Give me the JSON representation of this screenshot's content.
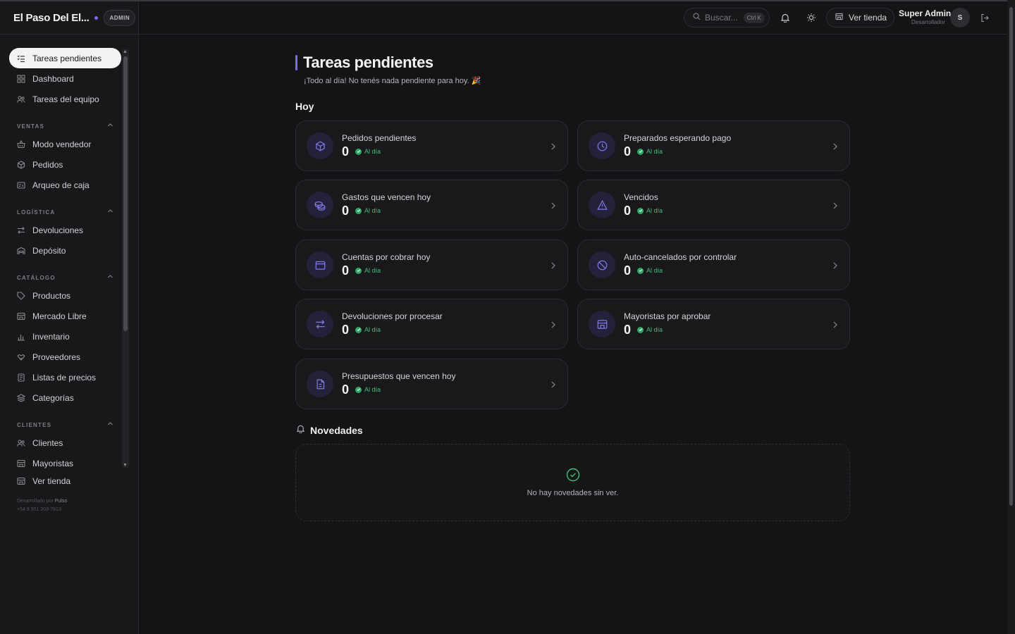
{
  "app": {
    "brand": "El Paso Del El...",
    "badge": "ADMIN"
  },
  "sidebar": {
    "top_items": [
      {
        "label": "Tareas pendientes",
        "icon": "list-check-icon",
        "active": true
      },
      {
        "label": "Dashboard",
        "icon": "grid-icon"
      },
      {
        "label": "Tareas del equipo",
        "icon": "users-icon"
      }
    ],
    "sections": [
      {
        "title": "VENTAS",
        "items": [
          {
            "label": "Modo vendedor",
            "icon": "basket-icon"
          },
          {
            "label": "Pedidos",
            "icon": "box-icon"
          },
          {
            "label": "Arqueo de caja",
            "icon": "cash-register-icon"
          }
        ]
      },
      {
        "title": "LOGÍSTICA",
        "items": [
          {
            "label": "Devoluciones",
            "icon": "arrows-swap-icon"
          },
          {
            "label": "Depósito",
            "icon": "warehouse-icon"
          }
        ]
      },
      {
        "title": "CATÁLOGO",
        "items": [
          {
            "label": "Productos",
            "icon": "tag-icon"
          },
          {
            "label": "Mercado Libre",
            "icon": "store-icon"
          },
          {
            "label": "Inventario",
            "icon": "bar-chart-icon"
          },
          {
            "label": "Proveedores",
            "icon": "handshake-icon"
          },
          {
            "label": "Listas de precios",
            "icon": "price-list-icon"
          },
          {
            "label": "Categorías",
            "icon": "layers-icon"
          }
        ]
      },
      {
        "title": "CLIENTES",
        "items": [
          {
            "label": "Clientes",
            "icon": "users-icon"
          },
          {
            "label": "Mayoristas",
            "icon": "store-icon"
          },
          {
            "label": "Ver tienda",
            "icon": "store-icon"
          }
        ]
      }
    ],
    "footer": {
      "prefix": "Desarrollado por",
      "brand": "Pulso",
      "phone": "+54 9 351 203-7813"
    }
  },
  "topbar": {
    "search_placeholder": "Buscar...",
    "search_shortcut": "Ctrl K",
    "store_label": "Ver tienda",
    "user_name": "Super Admin",
    "user_role": "Desarrollador",
    "avatar_initial": "S"
  },
  "main": {
    "title": "Tareas pendientes",
    "subtitle": "¡Todo al día! No tenés nada pendiente para hoy. 🎉",
    "section_today": "Hoy",
    "cards": [
      {
        "label": "Pedidos pendientes",
        "count": "0",
        "status": "Al día",
        "icon": "box-icon"
      },
      {
        "label": "Preparados esperando pago",
        "count": "0",
        "status": "Al día",
        "icon": "clock-icon"
      },
      {
        "label": "Gastos que vencen hoy",
        "count": "0",
        "status": "Al día",
        "icon": "coins-icon"
      },
      {
        "label": "Vencidos",
        "count": "0",
        "status": "Al día",
        "icon": "warning-icon"
      },
      {
        "label": "Cuentas por cobrar hoy",
        "count": "0",
        "status": "Al día",
        "icon": "wallet-icon"
      },
      {
        "label": "Auto-cancelados por controlar",
        "count": "0",
        "status": "Al día",
        "icon": "ban-icon"
      },
      {
        "label": "Devoluciones por procesar",
        "count": "0",
        "status": "Al día",
        "icon": "arrows-swap-icon"
      },
      {
        "label": "Mayoristas por aprobar",
        "count": "0",
        "status": "Al día",
        "icon": "store-icon"
      },
      {
        "label": "Presupuestos que vencen hoy",
        "count": "0",
        "status": "Al día",
        "icon": "document-icon"
      }
    ],
    "news_title": "Novedades",
    "news_empty": "No hay novedades sin ver."
  },
  "colors": {
    "accent": "#7c6cf0",
    "success": "#3fbf7a",
    "background": "#141416",
    "sidebar": "#18181b"
  }
}
